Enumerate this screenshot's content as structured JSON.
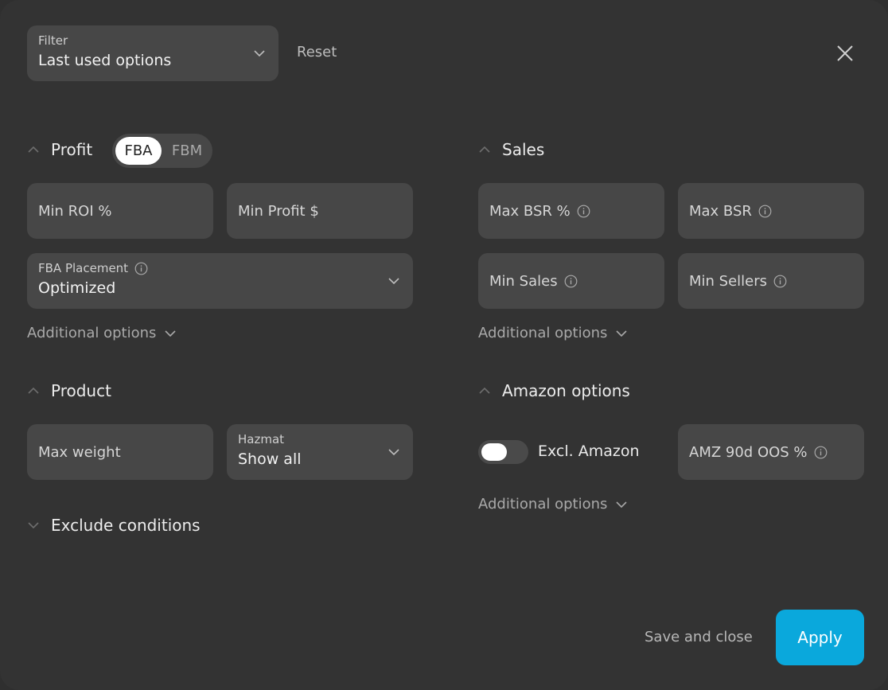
{
  "filter": {
    "label": "Filter",
    "value": "Last used options"
  },
  "reset_label": "Reset",
  "profit": {
    "title": "Profit",
    "mode_options": [
      "FBA",
      "FBM"
    ],
    "min_roi_placeholder": "Min ROI %",
    "min_profit_placeholder": "Min Profit $",
    "fba_placement": {
      "label": "FBA Placement",
      "value": "Optimized"
    },
    "additional_options": "Additional options"
  },
  "sales": {
    "title": "Sales",
    "max_bsr_pct_placeholder": "Max BSR %",
    "max_bsr_placeholder": "Max BSR",
    "min_sales_placeholder": "Min Sales",
    "min_sellers_placeholder": "Min Sellers",
    "additional_options": "Additional options"
  },
  "product": {
    "title": "Product",
    "max_weight_placeholder": "Max weight",
    "hazmat": {
      "label": "Hazmat",
      "value": "Show all"
    }
  },
  "amazon": {
    "title": "Amazon options",
    "excl_amazon_label": "Excl. Amazon",
    "excl_amazon_on": false,
    "amz_oos_placeholder": "AMZ 90d OOS %",
    "additional_options": "Additional options"
  },
  "exclude": {
    "title": "Exclude conditions"
  },
  "footer": {
    "save_close_label": "Save and close",
    "apply_label": "Apply"
  },
  "colors": {
    "accent": "#0aa8dc",
    "panel": "#333333",
    "field": "#474747"
  }
}
